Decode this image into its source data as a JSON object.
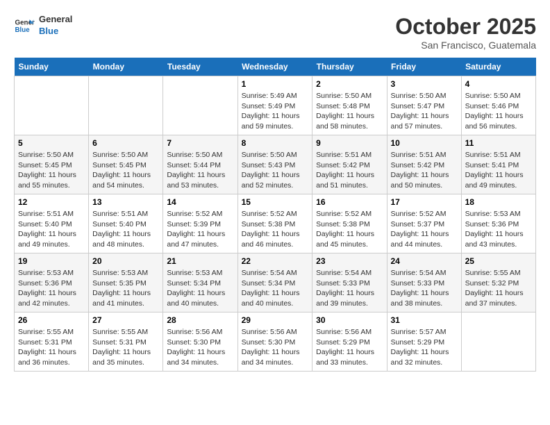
{
  "logo": {
    "line1": "General",
    "line2": "Blue"
  },
  "title": "October 2025",
  "location": "San Francisco, Guatemala",
  "weekdays": [
    "Sunday",
    "Monday",
    "Tuesday",
    "Wednesday",
    "Thursday",
    "Friday",
    "Saturday"
  ],
  "weeks": [
    [
      {
        "day": "",
        "info": ""
      },
      {
        "day": "",
        "info": ""
      },
      {
        "day": "",
        "info": ""
      },
      {
        "day": "1",
        "info": "Sunrise: 5:49 AM\nSunset: 5:49 PM\nDaylight: 11 hours\nand 59 minutes."
      },
      {
        "day": "2",
        "info": "Sunrise: 5:50 AM\nSunset: 5:48 PM\nDaylight: 11 hours\nand 58 minutes."
      },
      {
        "day": "3",
        "info": "Sunrise: 5:50 AM\nSunset: 5:47 PM\nDaylight: 11 hours\nand 57 minutes."
      },
      {
        "day": "4",
        "info": "Sunrise: 5:50 AM\nSunset: 5:46 PM\nDaylight: 11 hours\nand 56 minutes."
      }
    ],
    [
      {
        "day": "5",
        "info": "Sunrise: 5:50 AM\nSunset: 5:45 PM\nDaylight: 11 hours\nand 55 minutes."
      },
      {
        "day": "6",
        "info": "Sunrise: 5:50 AM\nSunset: 5:45 PM\nDaylight: 11 hours\nand 54 minutes."
      },
      {
        "day": "7",
        "info": "Sunrise: 5:50 AM\nSunset: 5:44 PM\nDaylight: 11 hours\nand 53 minutes."
      },
      {
        "day": "8",
        "info": "Sunrise: 5:50 AM\nSunset: 5:43 PM\nDaylight: 11 hours\nand 52 minutes."
      },
      {
        "day": "9",
        "info": "Sunrise: 5:51 AM\nSunset: 5:42 PM\nDaylight: 11 hours\nand 51 minutes."
      },
      {
        "day": "10",
        "info": "Sunrise: 5:51 AM\nSunset: 5:42 PM\nDaylight: 11 hours\nand 50 minutes."
      },
      {
        "day": "11",
        "info": "Sunrise: 5:51 AM\nSunset: 5:41 PM\nDaylight: 11 hours\nand 49 minutes."
      }
    ],
    [
      {
        "day": "12",
        "info": "Sunrise: 5:51 AM\nSunset: 5:40 PM\nDaylight: 11 hours\nand 49 minutes."
      },
      {
        "day": "13",
        "info": "Sunrise: 5:51 AM\nSunset: 5:40 PM\nDaylight: 11 hours\nand 48 minutes."
      },
      {
        "day": "14",
        "info": "Sunrise: 5:52 AM\nSunset: 5:39 PM\nDaylight: 11 hours\nand 47 minutes."
      },
      {
        "day": "15",
        "info": "Sunrise: 5:52 AM\nSunset: 5:38 PM\nDaylight: 11 hours\nand 46 minutes."
      },
      {
        "day": "16",
        "info": "Sunrise: 5:52 AM\nSunset: 5:38 PM\nDaylight: 11 hours\nand 45 minutes."
      },
      {
        "day": "17",
        "info": "Sunrise: 5:52 AM\nSunset: 5:37 PM\nDaylight: 11 hours\nand 44 minutes."
      },
      {
        "day": "18",
        "info": "Sunrise: 5:53 AM\nSunset: 5:36 PM\nDaylight: 11 hours\nand 43 minutes."
      }
    ],
    [
      {
        "day": "19",
        "info": "Sunrise: 5:53 AM\nSunset: 5:36 PM\nDaylight: 11 hours\nand 42 minutes."
      },
      {
        "day": "20",
        "info": "Sunrise: 5:53 AM\nSunset: 5:35 PM\nDaylight: 11 hours\nand 41 minutes."
      },
      {
        "day": "21",
        "info": "Sunrise: 5:53 AM\nSunset: 5:34 PM\nDaylight: 11 hours\nand 40 minutes."
      },
      {
        "day": "22",
        "info": "Sunrise: 5:54 AM\nSunset: 5:34 PM\nDaylight: 11 hours\nand 40 minutes."
      },
      {
        "day": "23",
        "info": "Sunrise: 5:54 AM\nSunset: 5:33 PM\nDaylight: 11 hours\nand 39 minutes."
      },
      {
        "day": "24",
        "info": "Sunrise: 5:54 AM\nSunset: 5:33 PM\nDaylight: 11 hours\nand 38 minutes."
      },
      {
        "day": "25",
        "info": "Sunrise: 5:55 AM\nSunset: 5:32 PM\nDaylight: 11 hours\nand 37 minutes."
      }
    ],
    [
      {
        "day": "26",
        "info": "Sunrise: 5:55 AM\nSunset: 5:31 PM\nDaylight: 11 hours\nand 36 minutes."
      },
      {
        "day": "27",
        "info": "Sunrise: 5:55 AM\nSunset: 5:31 PM\nDaylight: 11 hours\nand 35 minutes."
      },
      {
        "day": "28",
        "info": "Sunrise: 5:56 AM\nSunset: 5:30 PM\nDaylight: 11 hours\nand 34 minutes."
      },
      {
        "day": "29",
        "info": "Sunrise: 5:56 AM\nSunset: 5:30 PM\nDaylight: 11 hours\nand 34 minutes."
      },
      {
        "day": "30",
        "info": "Sunrise: 5:56 AM\nSunset: 5:29 PM\nDaylight: 11 hours\nand 33 minutes."
      },
      {
        "day": "31",
        "info": "Sunrise: 5:57 AM\nSunset: 5:29 PM\nDaylight: 11 hours\nand 32 minutes."
      },
      {
        "day": "",
        "info": ""
      }
    ]
  ]
}
